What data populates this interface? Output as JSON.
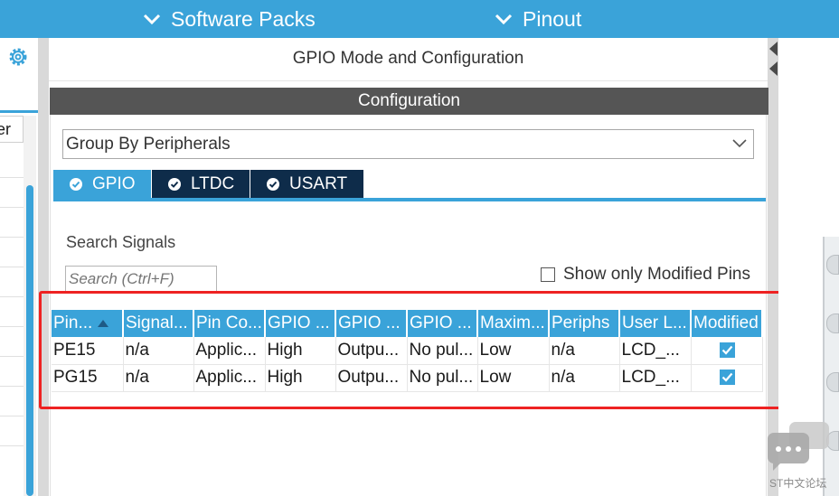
{
  "topbar": {
    "menu_software_packs": "Software Packs",
    "menu_pinout": "Pinout",
    "background_color": "#3aa3d9"
  },
  "left_panel": {
    "column_header_partial": "er",
    "icon": "gear-icon"
  },
  "main": {
    "title": "GPIO Mode and Configuration",
    "config_bar_label": "Configuration"
  },
  "config": {
    "group_by": {
      "selected": "Group By Peripherals"
    },
    "tabs": [
      {
        "label": "GPIO",
        "active": true
      },
      {
        "label": "LTDC",
        "active": false
      },
      {
        "label": "USART",
        "active": false
      }
    ],
    "search": {
      "label": "Search Signals",
      "placeholder": "Search (Ctrl+F)"
    },
    "show_modified": {
      "label": "Show only Modified Pins",
      "checked": false
    },
    "table": {
      "headers": [
        "Pin...",
        "Signal...",
        "Pin Co...",
        "GPIO ...",
        "GPIO ...",
        "GPIO ...",
        "Maxim...",
        "Periphs",
        "User L...",
        "Modified"
      ],
      "rows": [
        [
          "PE15",
          "n/a",
          "Applic...",
          "High",
          "Outpu...",
          "No pul...",
          "Low",
          "n/a",
          "LCD_...",
          true
        ],
        [
          "PG15",
          "n/a",
          "Applic...",
          "High",
          "Outpu...",
          "No pul...",
          "Low",
          "n/a",
          "LCD_...",
          true
        ]
      ]
    }
  },
  "watermark": {
    "text": "ST中文论坛"
  },
  "colors": {
    "accent": "#3aa3d9",
    "tab_inactive": "#0e2c4a",
    "config_bar": "#555555",
    "highlight": "#ee2222"
  }
}
